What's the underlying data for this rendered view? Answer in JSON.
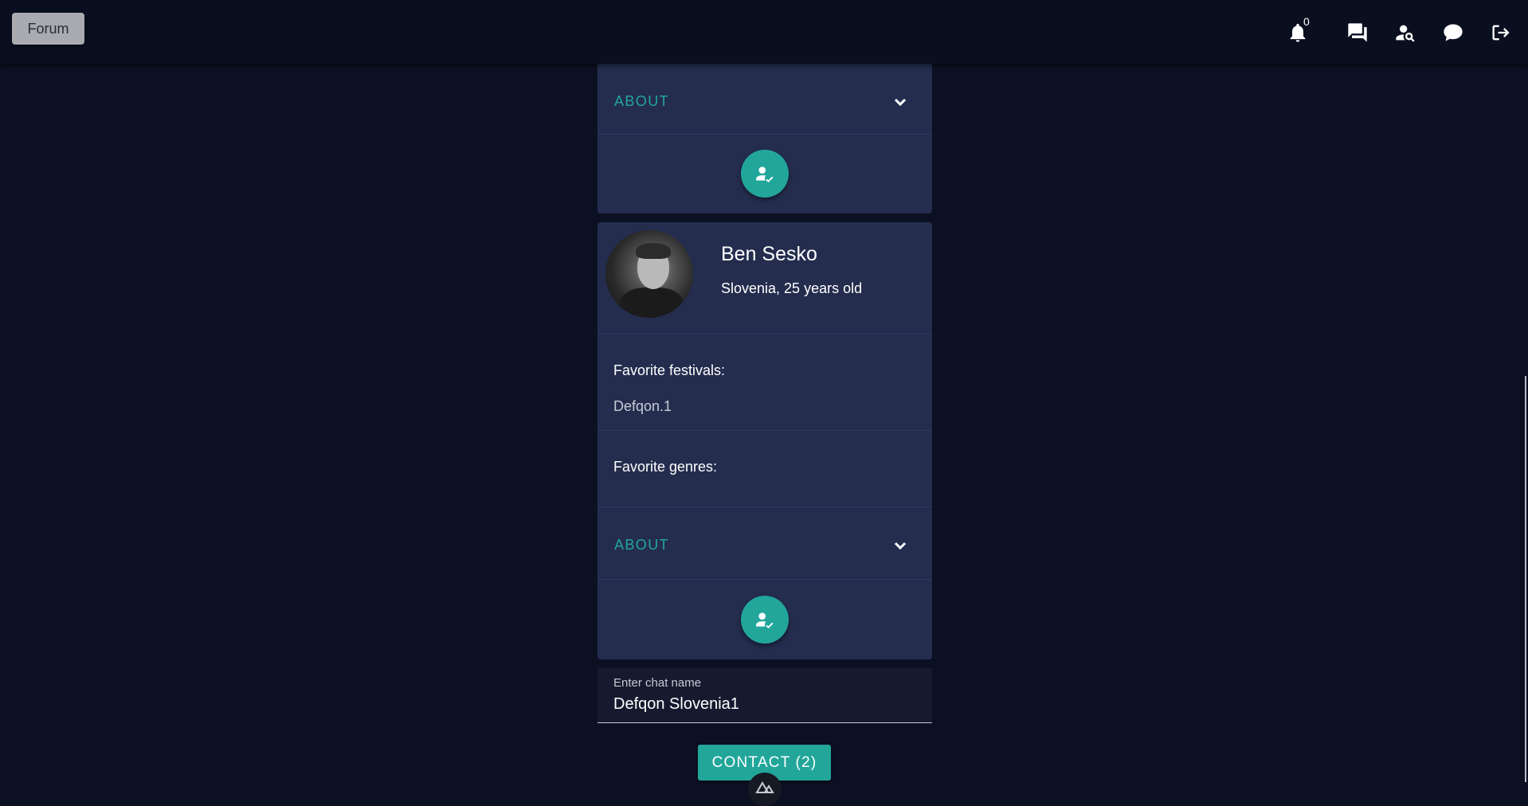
{
  "header": {
    "forum_label": "Forum",
    "notification_count": "0",
    "icons": [
      "bell-icon",
      "forum-icon",
      "person-search-icon",
      "chat-bubble-icon",
      "logout-icon"
    ]
  },
  "cards": [
    {
      "about_label": "ABOUT"
    },
    {
      "name": "Ben Sesko",
      "location": "Slovenia, 25 years old",
      "festivals_title": "Favorite festivals:",
      "festivals_value": "Defqon.1",
      "genres_title": "Favorite genres:",
      "genres_value": "",
      "about_label": "ABOUT"
    }
  ],
  "chat": {
    "label": "Enter chat name",
    "value": "Defqon Slovenia1"
  },
  "contact_button": "CONTACT (2)",
  "colors": {
    "background": "#0b1022",
    "card": "#242d4e",
    "accent": "#22a69a"
  }
}
